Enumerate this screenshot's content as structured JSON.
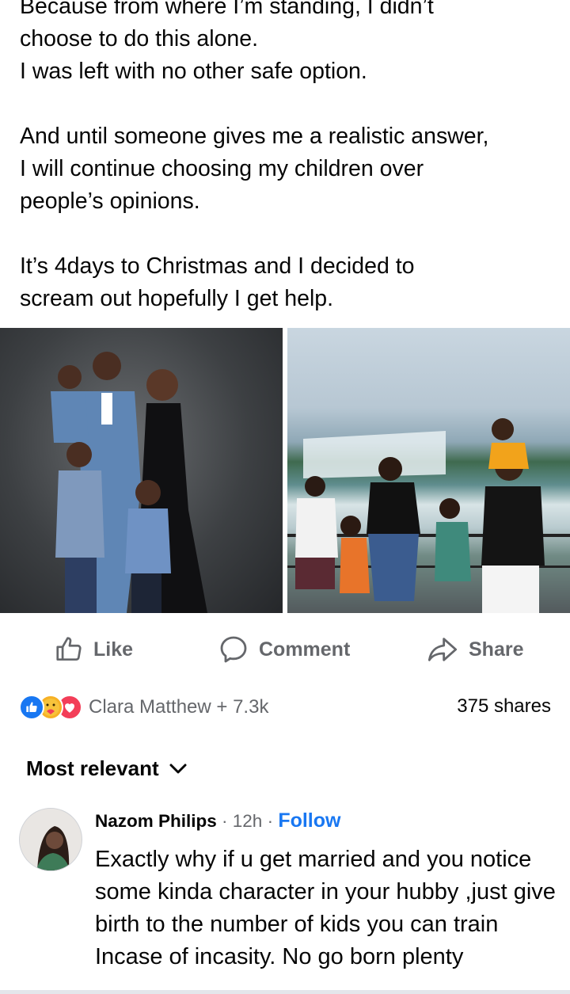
{
  "post": {
    "text_lines": [
      "Because from where I’m standing, I didn’t",
      "choose to do this alone.",
      "I was left with no other safe option.",
      "",
      "And until someone gives me a realistic answer,",
      "I will continue choosing my children over",
      "people’s opinions.",
      "",
      "It’s 4days to Christmas and I decided to",
      "scream out hopefully I get help."
    ]
  },
  "actions": {
    "like_label": "Like",
    "comment_label": "Comment",
    "share_label": "Share"
  },
  "reactions": {
    "icons": [
      "like-reaction-icon",
      "care-reaction-icon",
      "love-reaction-icon"
    ],
    "summary": "Clara Matthew + 7.3k",
    "shares": "375 shares"
  },
  "comments_sort": {
    "label": "Most relevant"
  },
  "comment": {
    "author": "Nazom Philips",
    "meta": " · 12h · ",
    "follow_label": "Follow",
    "text": "Exactly why if u get married and you notice some kinda character in your hubby ,just give birth to the number of kids you can train Incase of incasity.  No go born plenty"
  },
  "colors": {
    "accent": "#1877f2",
    "secondary_text": "#65676b",
    "love": "#f33e58",
    "care": "#f7b125"
  }
}
